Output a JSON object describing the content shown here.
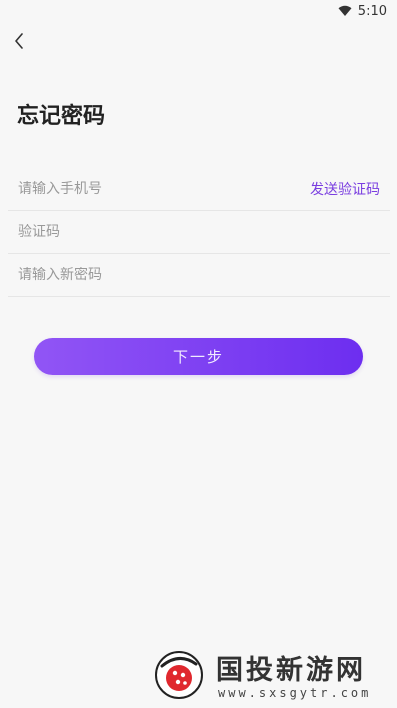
{
  "status_bar": {
    "time": "5:10"
  },
  "page": {
    "title": "忘记密码"
  },
  "form": {
    "phone_placeholder": "请输入手机号",
    "send_code_label": "发送验证码",
    "code_placeholder": "验证码",
    "new_password_placeholder": "请输入新密码"
  },
  "actions": {
    "next_label": "下一步"
  },
  "watermark": {
    "name": "国投新游网",
    "url": "www.sxsgytr.com"
  },
  "colors": {
    "accent": "#7a3ee0",
    "button_start": "#9155f5",
    "button_end": "#6d2ef0",
    "background": "#f7f7f7"
  }
}
